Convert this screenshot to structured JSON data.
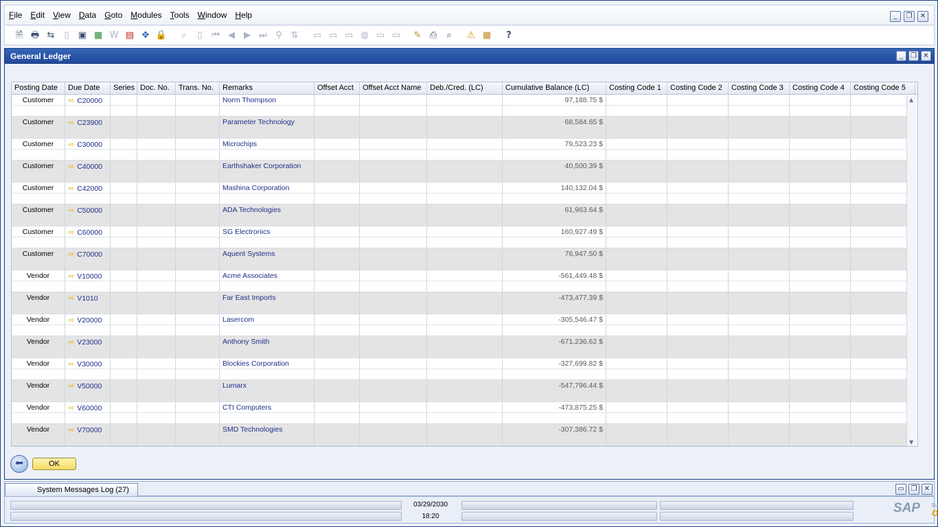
{
  "menu": [
    "File",
    "Edit",
    "View",
    "Data",
    "Goto",
    "Modules",
    "Tools",
    "Window",
    "Help"
  ],
  "window_title": "General Ledger",
  "columns": [
    "Posting Date",
    "Due Date",
    "Series",
    "Doc. No.",
    "Trans. No.",
    "Remarks",
    "Offset Acct",
    "Offset Acct Name",
    "Deb./Cred. (LC)",
    "Cumulative Balance (LC)",
    "Costing Code 1",
    "Costing Code 2",
    "Costing Code 3",
    "Costing Code 4",
    "Costing Code 5"
  ],
  "rows": [
    {
      "type": "Customer",
      "code": "C20000",
      "name": "Norm Thompson",
      "balance": "97,188.75 $"
    },
    {
      "type": "Customer",
      "code": "C23900",
      "name": "Parameter Technology",
      "balance": "68,584.65 $"
    },
    {
      "type": "Customer",
      "code": "C30000",
      "name": "Microchips",
      "balance": "79,523.23 $"
    },
    {
      "type": "Customer",
      "code": "C40000",
      "name": "Earthshaker Corporation",
      "balance": "40,500.39 $"
    },
    {
      "type": "Customer",
      "code": "C42000",
      "name": "Mashina Corporation",
      "balance": "140,132.04 $"
    },
    {
      "type": "Customer",
      "code": "C50000",
      "name": "ADA Technologies",
      "balance": "61,963.64 $"
    },
    {
      "type": "Customer",
      "code": "C60000",
      "name": "SG Electronics",
      "balance": "160,927.49 $"
    },
    {
      "type": "Customer",
      "code": "C70000",
      "name": "Aquent Systems",
      "balance": "76,947.50 $"
    },
    {
      "type": "Vendor",
      "code": "V10000",
      "name": "Acme Associates",
      "balance": "-561,449.48 $"
    },
    {
      "type": "Vendor",
      "code": "V1010",
      "name": "Far East Imports",
      "balance": "-473,477.39 $"
    },
    {
      "type": "Vendor",
      "code": "V20000",
      "name": "Lasercom",
      "balance": "-305,546.47 $"
    },
    {
      "type": "Vendor",
      "code": "V23000",
      "name": "Anthony Smith",
      "balance": "-671,236.62 $"
    },
    {
      "type": "Vendor",
      "code": "V30000",
      "name": "Blockies Corporation",
      "balance": "-327,699.82 $"
    },
    {
      "type": "Vendor",
      "code": "V50000",
      "name": "Lumarx",
      "balance": "-547,796.44 $"
    },
    {
      "type": "Vendor",
      "code": "V60000",
      "name": "CTI Computers",
      "balance": "-473,875.25 $"
    },
    {
      "type": "Vendor",
      "code": "V70000",
      "name": "SMD Technologies",
      "balance": "-307,386.72 $"
    }
  ],
  "ok_label": "OK",
  "messages_tab": "System Messages Log (27)",
  "status": {
    "date": "03/29/2030",
    "time": "18:20"
  },
  "logo": {
    "sap": "SAP",
    "business": "Business",
    "one": "One"
  },
  "colors": {
    "title_bar": "#2a52a6",
    "link": "#1f2f8a",
    "alt_row": "#e4e4e4",
    "ok_button": "#f5dc64"
  }
}
